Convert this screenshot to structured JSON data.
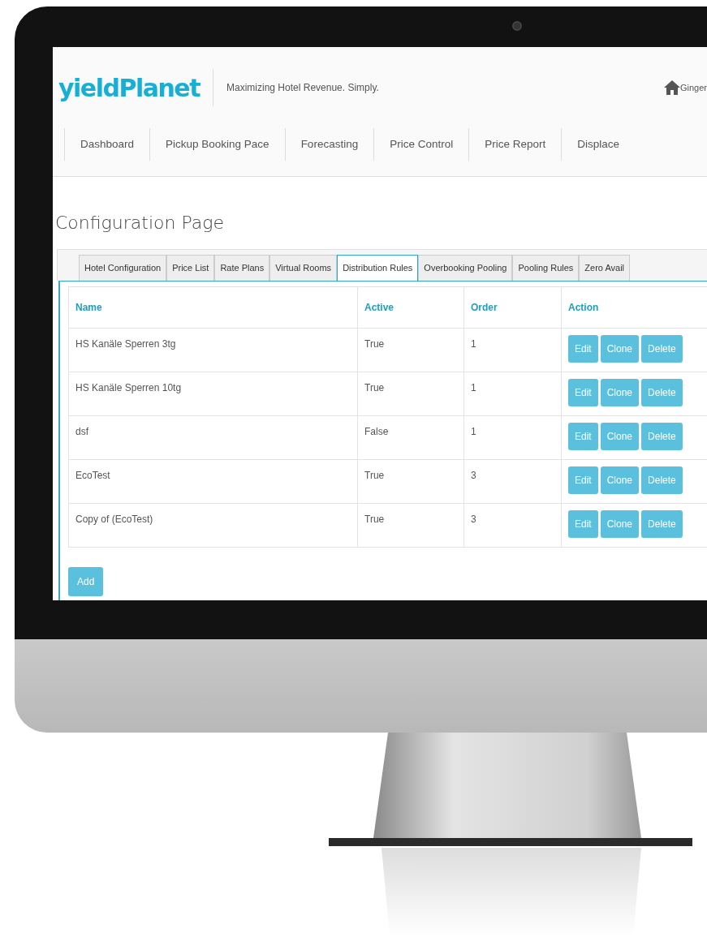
{
  "header": {
    "logo": "yieldPlanet",
    "tagline": "Maximizing Hotel Revenue. Simply.",
    "user": "Ginger"
  },
  "nav": [
    "Dashboard",
    "Pickup Booking Pace",
    "Forecasting",
    "Price Control",
    "Price Report",
    "Displace"
  ],
  "page_title": "Configuration Page",
  "tabs": [
    {
      "label": "Hotel Configuration",
      "selected": false
    },
    {
      "label": "Price List",
      "selected": false
    },
    {
      "label": "Rate Plans",
      "selected": false
    },
    {
      "label": "Virtual Rooms",
      "selected": false
    },
    {
      "label": "Distribution Rules",
      "selected": true
    },
    {
      "label": "Overbooking Pooling",
      "selected": false
    },
    {
      "label": "Pooling Rules",
      "selected": false
    },
    {
      "label": "Zero Avail",
      "selected": false
    }
  ],
  "table": {
    "columns": [
      "Name",
      "Active",
      "Order",
      "Action"
    ],
    "rows": [
      {
        "name": "HS Kanäle Sperren 3tg",
        "active": "True",
        "order": "1",
        "actions": [
          "Edit",
          "Clone",
          "Delete"
        ]
      },
      {
        "name": "HS Kanäle Sperren 10tg",
        "active": "True",
        "order": "1",
        "actions": [
          "Edit",
          "Clone",
          "Delete"
        ]
      },
      {
        "name": "dsf",
        "active": "False",
        "order": "1",
        "actions": [
          "Edit",
          "Clone",
          "Delete"
        ]
      },
      {
        "name": "EcoTest",
        "active": "True",
        "order": "3",
        "actions": [
          "Edit",
          "Clone",
          "Delete"
        ]
      },
      {
        "name": "Copy of (EcoTest)",
        "active": "True",
        "order": "3",
        "actions": [
          "Edit",
          "Clone",
          "Delete"
        ]
      }
    ]
  },
  "add_button": "Add"
}
